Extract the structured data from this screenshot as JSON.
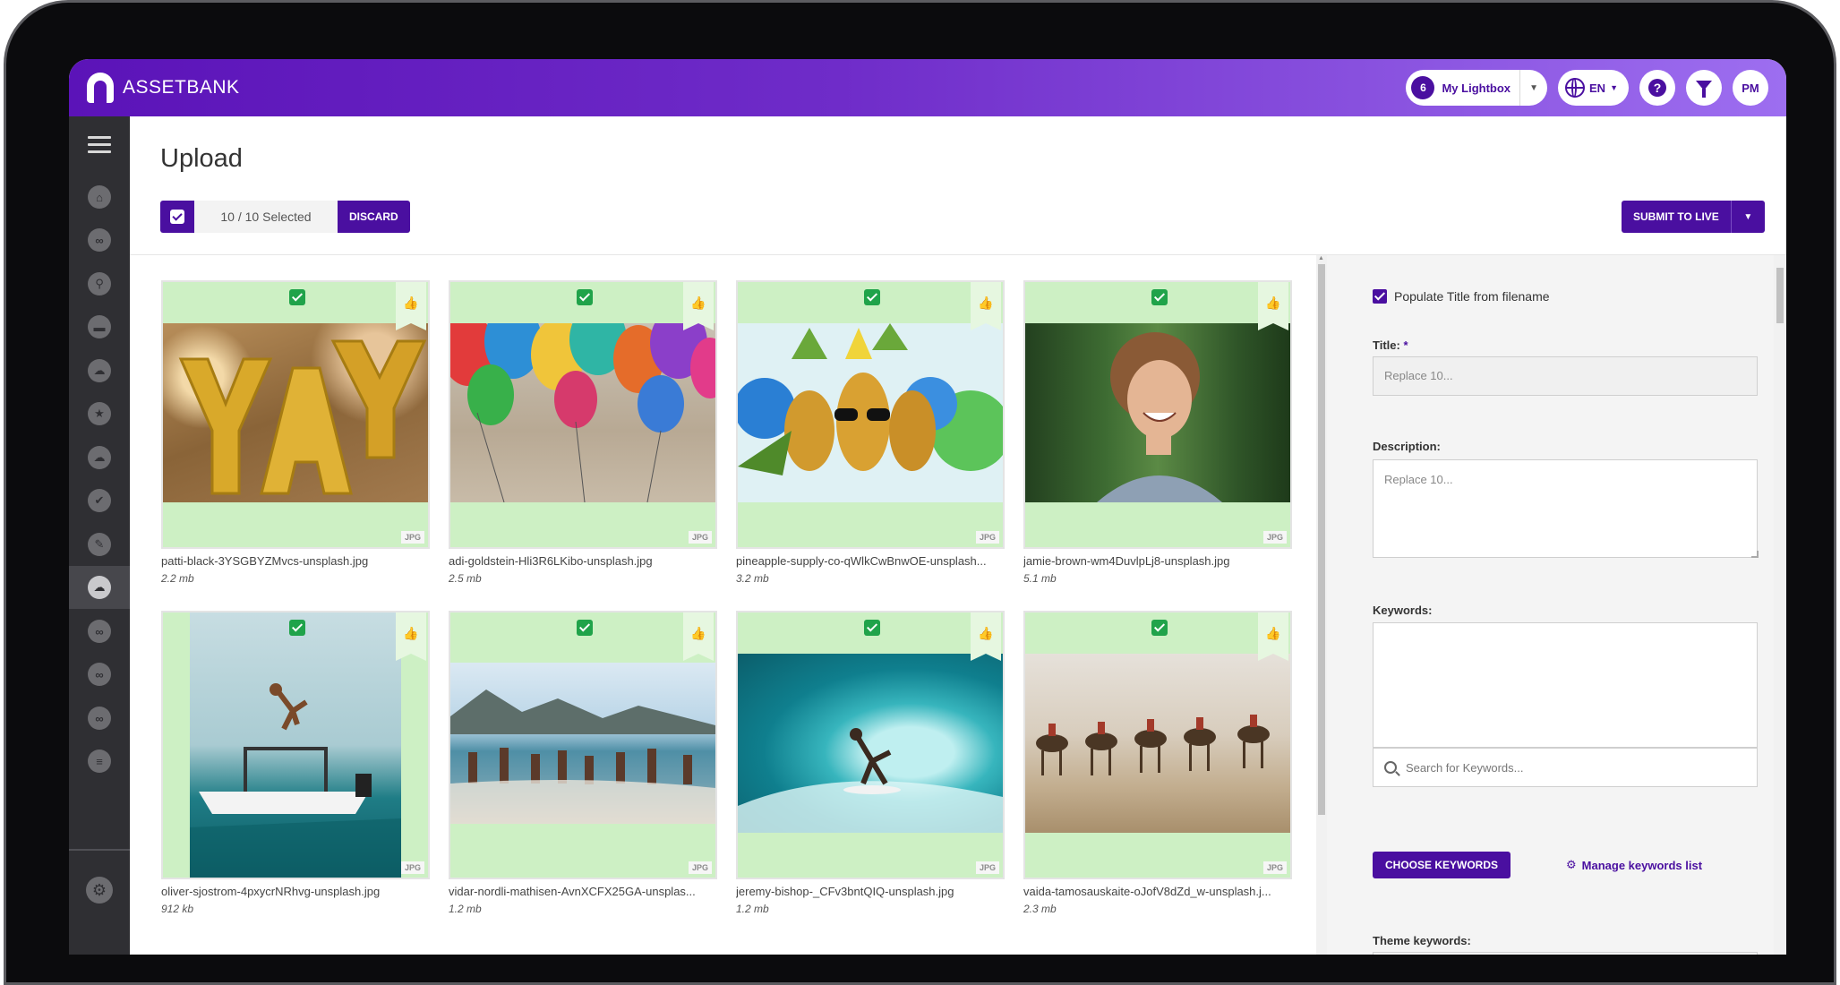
{
  "app": {
    "brand": "ASSETBANK"
  },
  "topbar": {
    "lightbox_count": "6",
    "lightbox_label": "My Lightbox",
    "language": "EN",
    "help_icon": "?",
    "user_initials": "PM"
  },
  "sidebar": {
    "items": [
      {
        "icon": "home-icon",
        "glyph": "⌂"
      },
      {
        "icon": "link-icon",
        "glyph": "∞"
      },
      {
        "icon": "search-icon",
        "glyph": "⚲"
      },
      {
        "icon": "folder-icon",
        "glyph": "▬"
      },
      {
        "icon": "cloud-upload-icon",
        "glyph": "☁"
      },
      {
        "icon": "star-icon",
        "glyph": "★"
      },
      {
        "icon": "cloud-icon",
        "glyph": "☁"
      },
      {
        "icon": "check-icon",
        "glyph": "✔"
      },
      {
        "icon": "pencil-icon",
        "glyph": "✎"
      },
      {
        "icon": "cloud-upload-icon",
        "glyph": "☁"
      },
      {
        "icon": "link-icon",
        "glyph": "∞"
      },
      {
        "icon": "link-icon",
        "glyph": "∞"
      },
      {
        "icon": "link-icon",
        "glyph": "∞"
      },
      {
        "icon": "document-icon",
        "glyph": "≡"
      },
      {
        "icon": "gear-icon",
        "glyph": "⚙"
      }
    ]
  },
  "page": {
    "title": "Upload",
    "selected": "10",
    "selected_suffix": "/ 10 Selected",
    "discard_label": "DISCARD",
    "submit_label": "SUBMIT TO LIVE"
  },
  "assets": [
    {
      "name": "patti-black-3YSGBYZMvcs-unsplash.jpg",
      "size": "2.2 mb",
      "type": "JPG"
    },
    {
      "name": "adi-goldstein-Hli3R6LKibo-unsplash.jpg",
      "size": "2.5 mb",
      "type": "JPG"
    },
    {
      "name": "pineapple-supply-co-qWlkCwBnwOE-unsplash...",
      "size": "3.2 mb",
      "type": "JPG"
    },
    {
      "name": "jamie-brown-wm4DuvlpLj8-unsplash.jpg",
      "size": "5.1 mb",
      "type": "JPG"
    },
    {
      "name": "oliver-sjostrom-4pxycrNRhvg-unsplash.jpg",
      "size": "912 kb",
      "type": "JPG"
    },
    {
      "name": "vidar-nordli-mathisen-AvnXCFX25GA-unsplas...",
      "size": "1.2 mb",
      "type": "JPG"
    },
    {
      "name": "jeremy-bishop-_CFv3bntQIQ-unsplash.jpg",
      "size": "1.2 mb",
      "type": "JPG"
    },
    {
      "name": "vaida-tamosauskaite-oJofV8dZd_w-unsplash.j...",
      "size": "2.3 mb",
      "type": "JPG"
    }
  ],
  "panel": {
    "populate_label": "Populate Title from filename",
    "title_label": "Title:",
    "required_mark": "*",
    "title_placeholder": "Replace 10...",
    "description_label": "Description:",
    "description_placeholder": "Replace 10...",
    "keywords_label": "Keywords:",
    "keywords_search_placeholder": "Search for Keywords...",
    "choose_keywords": "CHOOSE KEYWORDS",
    "manage_keywords": "Manage keywords list",
    "theme_keywords_label": "Theme keywords:"
  }
}
